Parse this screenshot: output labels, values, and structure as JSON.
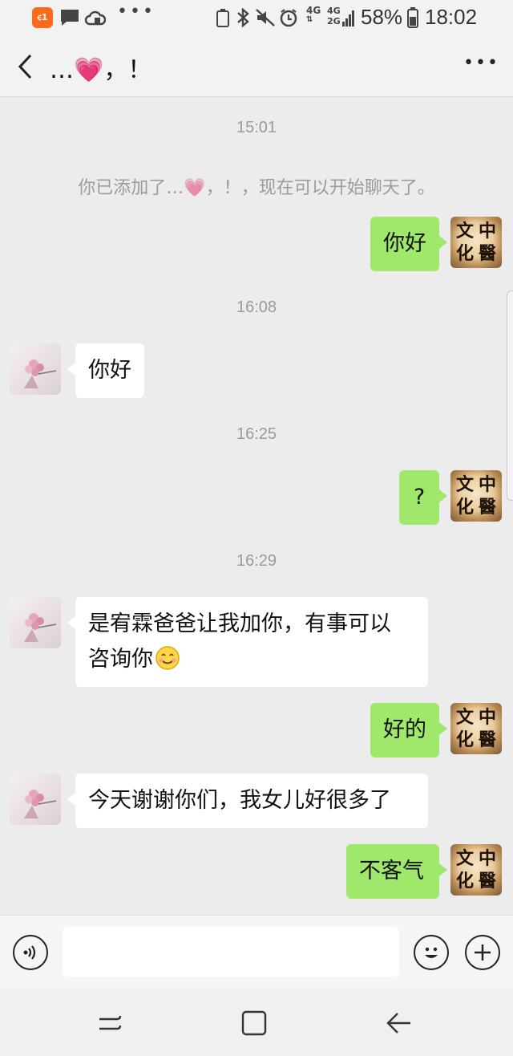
{
  "status_bar": {
    "battery_percent": "58%",
    "time": "18:02",
    "net_top": "4G",
    "net_bottom": "2G",
    "net_main": "4G",
    "app_badge": "ꞓ1"
  },
  "header": {
    "title_prefix": "…",
    "title_suffix": "，！",
    "heart": "💗"
  },
  "messages": {
    "ts1": "15:01",
    "system_prefix": "你已添加了…",
    "system_suffix": "，！，现在可以开始聊天了。",
    "m1": "你好",
    "ts2": "16:08",
    "m2": "你好",
    "ts3": "16:25",
    "m3": "?",
    "ts4": "16:29",
    "m4_line1": "是宥霖爸爸让我加你，有事可以",
    "m4_line2": "咨询你",
    "m5": "好的",
    "m6": "今天谢谢你们，我女儿好很多了",
    "m7": "不客气"
  },
  "my_avatar": {
    "c1": "中",
    "c2": "文",
    "c3": "醫",
    "c4": "化"
  },
  "input": {
    "placeholder": ""
  },
  "colors": {
    "my_bubble": "#9fe86c",
    "their_bubble": "#ffffff",
    "background": "#ececec",
    "heart": "#f04a9a"
  }
}
